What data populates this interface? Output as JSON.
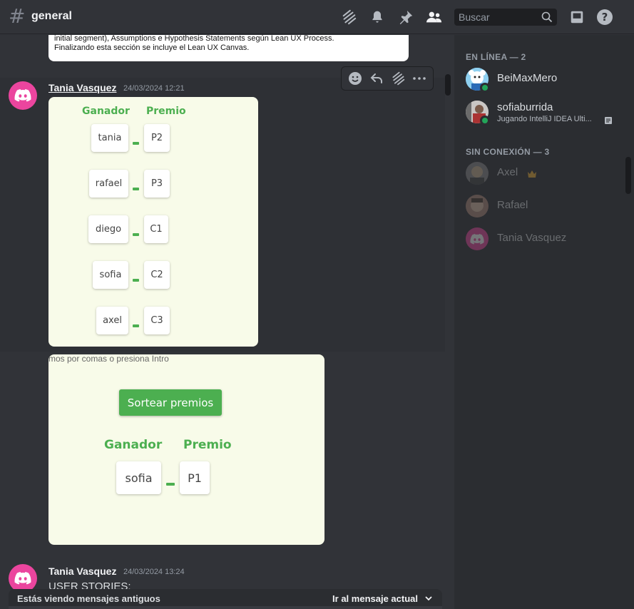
{
  "header": {
    "channel": "general",
    "search_placeholder": "Buscar"
  },
  "previous_card": {
    "line1": "initial segment), Assumptions e Hypothesis Statements según Lean UX Process.",
    "line2": "Finalizando esta sección se incluye el Lean UX Canvas."
  },
  "message1": {
    "author": "Tania Vasquez",
    "timestamp": "24/03/2024 12:21",
    "image": {
      "header_winner": "Ganador",
      "header_prize": "Premio",
      "rows": [
        {
          "winner": "tania",
          "prize": "P2"
        },
        {
          "winner": "rafael",
          "prize": "P3"
        },
        {
          "winner": "diego",
          "prize": "C1"
        },
        {
          "winner": "sofia",
          "prize": "C2"
        },
        {
          "winner": "axel",
          "prize": "C3"
        }
      ]
    }
  },
  "image2": {
    "overflow_text": "mos por comas o presiona Intro",
    "button": "Sortear premios",
    "header_winner": "Ganador",
    "header_prize": "Premio",
    "winner": "sofia",
    "prize": "P1"
  },
  "message2": {
    "author": "Tania Vasquez",
    "timestamp": "24/03/2024 13:24",
    "text": "USER STORIES:"
  },
  "old_messages_bar": {
    "left": "Estás viendo mensajes antiguos",
    "right": "Ir al mensaje actual"
  },
  "members": {
    "online_header": "EN LÍNEA — 2",
    "offline_header": "SIN CONEXIÓN — 3",
    "online": [
      {
        "name": "BeiMaxMero",
        "status": ""
      },
      {
        "name": "sofiaburrida",
        "status": "Jugando IntelliJ IDEA Ulti..."
      }
    ],
    "offline": [
      {
        "name": "Axel"
      },
      {
        "name": "Rafael"
      },
      {
        "name": "Tania Vasquez"
      }
    ]
  },
  "colors": {
    "accent_green": "#4caf50",
    "discord_pink": "#eb459e",
    "online": "#23a559"
  }
}
